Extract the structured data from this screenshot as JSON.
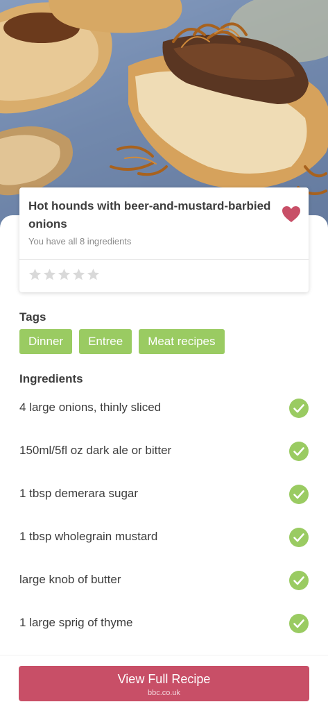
{
  "recipe": {
    "title": "Hot hounds with beer-and-mustard-barbied onions",
    "availability": "You have all 8 ingredients",
    "rating": 0,
    "max_rating": 5,
    "favorited": true,
    "image_icon": "recipe-photo"
  },
  "tags": {
    "heading": "Tags",
    "items": [
      "Dinner",
      "Entree",
      "Meat recipes"
    ]
  },
  "ingredients": {
    "heading": "Ingredients",
    "items": [
      {
        "text": "4 large onions, thinly sliced",
        "have": true
      },
      {
        "text": "150ml/5fl oz dark ale or bitter",
        "have": true
      },
      {
        "text": "1 tbsp demerara sugar",
        "have": true
      },
      {
        "text": "1 tbsp wholegrain mustard",
        "have": true
      },
      {
        "text": "large knob of butter",
        "have": true
      },
      {
        "text": "1 large sprig of thyme",
        "have": true
      }
    ]
  },
  "cta": {
    "label": "View Full Recipe",
    "source": "bbc.co.uk"
  },
  "colors": {
    "accent": "#c84f67",
    "tag": "#9acb62",
    "check": "#9acb62",
    "heart": "#c84f67",
    "star_empty": "#d9d9d9"
  }
}
